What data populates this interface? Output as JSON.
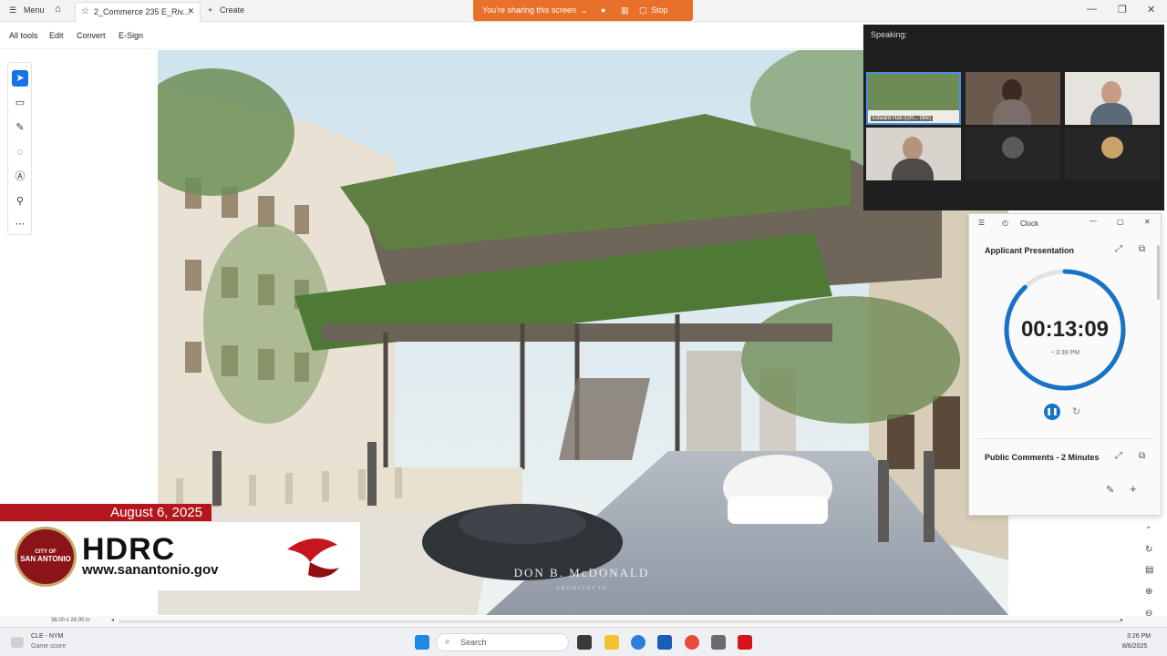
{
  "titlebar": {
    "menu_label": "Menu",
    "tab_title": "2_Commerce 235 E_Riv...",
    "create_label": "Create",
    "share_text": "You're sharing this screen",
    "stop_label": "Stop"
  },
  "toolbar": {
    "all_tools": "All tools",
    "edit": "Edit",
    "convert": "Convert",
    "esign": "E-Sign"
  },
  "document": {
    "watermark": "DON B. McDONALD",
    "watermark_sub": "ARCHITECTS",
    "page_size": "36.00 x 24.00 in"
  },
  "broadcast": {
    "date": "August 6, 2025",
    "seal_line1": "CITY OF",
    "seal_line2": "SAN ANTONIO",
    "title": "HDRC",
    "url": "www.sanantonio.gov"
  },
  "meeting": {
    "speaking_label": "Speaking:",
    "self_tile_label": "Edward Hall (OH... (Me)"
  },
  "clock": {
    "app_title": "Clock",
    "timer1_title": "Applicant Presentation",
    "timer1_time": "00:13:09",
    "timer1_end": "3:39 PM",
    "timer1_progress": 0.88,
    "timer2_title": "Public Comments - 2 Minutes"
  },
  "taskbar": {
    "weather_line1": "CLE - NYM",
    "weather_line2": "Game score",
    "search_placeholder": "Search",
    "time": "3:26 PM",
    "date": "8/6/2025"
  }
}
